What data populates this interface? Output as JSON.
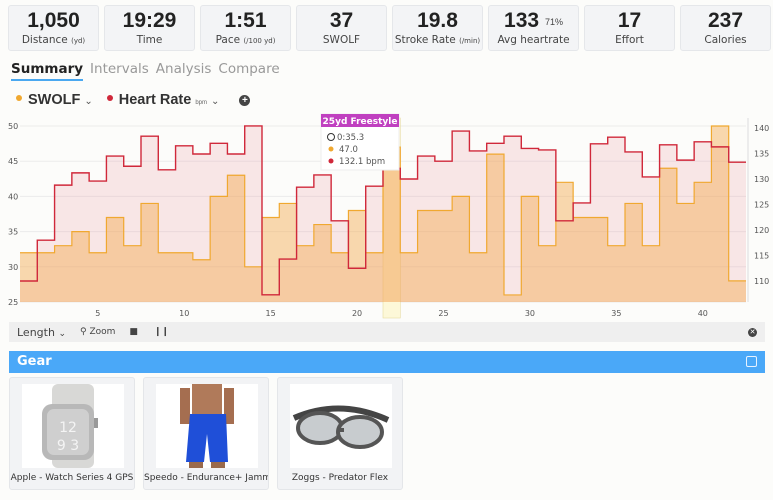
{
  "stats": [
    {
      "value": "1,050",
      "label": "Distance",
      "unit": "(yd)"
    },
    {
      "value": "19:29",
      "label": "Time",
      "unit": ""
    },
    {
      "value": "1:51",
      "label": "Pace",
      "unit": "(/100 yd)"
    },
    {
      "value": "37",
      "label": "SWOLF",
      "unit": ""
    },
    {
      "value": "19.8",
      "label": "Stroke Rate",
      "unit": "(/min)"
    },
    {
      "value": "133",
      "sup": "71%",
      "label": "Avg heartrate",
      "unit": ""
    },
    {
      "value": "17",
      "label": "Effort",
      "unit": ""
    },
    {
      "value": "237",
      "label": "Calories",
      "unit": ""
    }
  ],
  "tabs": [
    {
      "label": "Summary",
      "active": true
    },
    {
      "label": "Intervals",
      "active": false
    },
    {
      "label": "Analysis",
      "active": false
    },
    {
      "label": "Compare",
      "active": false
    }
  ],
  "series_selectors": [
    {
      "label": "SWOLF",
      "unit": "",
      "color": "#f0a830"
    },
    {
      "label": "Heart Rate",
      "unit": "bpm",
      "color": "#d0283a"
    }
  ],
  "tooltip": {
    "title": "25yd Freestyle",
    "time": "0:35.3",
    "swolf": "47.0",
    "hr": "132.1 bpm"
  },
  "toolbar": {
    "length_label": "Length",
    "zoom_label": "Zoom"
  },
  "gear": {
    "title": "Gear",
    "items": [
      {
        "name": "Apple - Watch Series 4 GPS"
      },
      {
        "name": "Speedo - Endurance+ Jammer"
      },
      {
        "name": "Zoggs - Predator Flex"
      }
    ]
  },
  "chart_data": {
    "type": "line",
    "step": true,
    "x": [
      1,
      2,
      3,
      4,
      5,
      6,
      7,
      8,
      9,
      10,
      11,
      12,
      13,
      14,
      15,
      16,
      17,
      18,
      19,
      20,
      21,
      22,
      23,
      24,
      25,
      26,
      27,
      28,
      29,
      30,
      31,
      32,
      33,
      34,
      35,
      36,
      37,
      38,
      39,
      40,
      41,
      42
    ],
    "xticks": [
      5,
      10,
      15,
      20,
      25,
      30,
      35,
      40
    ],
    "highlight_x": 22,
    "left_axis": {
      "ylim": [
        25,
        50
      ],
      "ticks": [
        25,
        30,
        35,
        40,
        45,
        50
      ]
    },
    "right_axis": {
      "ylim": [
        106,
        141
      ],
      "ticks": [
        110,
        115,
        120,
        125,
        130,
        135,
        140
      ]
    },
    "series": [
      {
        "name": "SWOLF",
        "axis": "left",
        "color": "#f0a830",
        "values": [
          32,
          32,
          33,
          35,
          32,
          37,
          33,
          39,
          32,
          32,
          31,
          40,
          43,
          30,
          37,
          39,
          33,
          36,
          32,
          38,
          32,
          47,
          32,
          38,
          38,
          40,
          32,
          46,
          26,
          40,
          33,
          42,
          37,
          37,
          33,
          39,
          33,
          44,
          39,
          42,
          50,
          28
        ]
      },
      {
        "name": "Heart Rate",
        "axis": "right",
        "unit": "bpm",
        "color": "#d0283a",
        "values": [
          110,
          118,
          128.8,
          131.2,
          129.6,
          134.5,
          132.5,
          138.4,
          131.8,
          136.5,
          134.9,
          137,
          134.9,
          140.4,
          107.3,
          114.3,
          128.4,
          130.8,
          121.8,
          112.5,
          128.6,
          132.1,
          130,
          134.5,
          133.5,
          139.4,
          135.5,
          137,
          138.4,
          136,
          135.7,
          121.8,
          125.3,
          136.9,
          138.2,
          135.3,
          130.4,
          136.7,
          133.7,
          137.3,
          136.3,
          133.3
        ]
      }
    ]
  }
}
